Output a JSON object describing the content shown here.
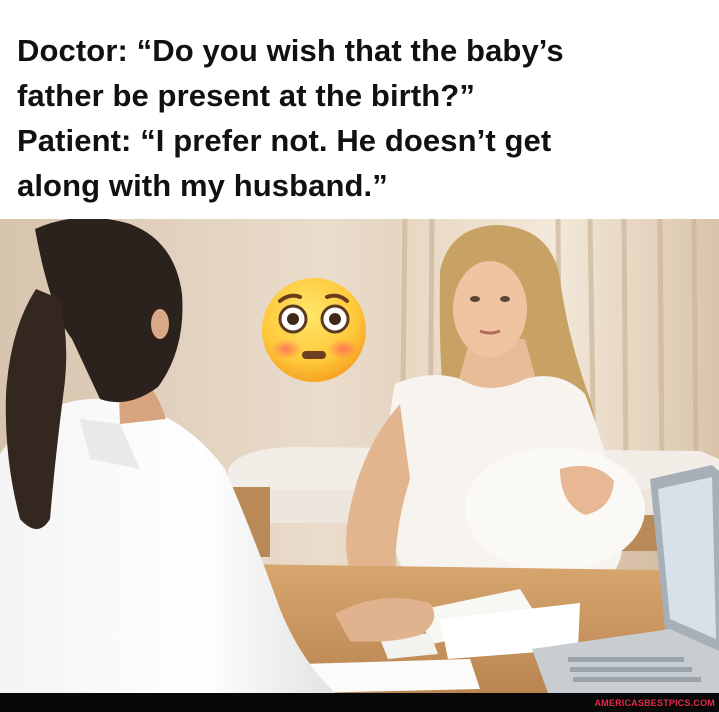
{
  "caption": {
    "lines": [
      "Doctor: “Do you wish that the baby’s",
      "father be present at the birth?”",
      "Patient: “I prefer not. He doesn’t get",
      "along with my husband.”"
    ]
  },
  "photo": {
    "emoji": "flushed-face-icon"
  },
  "watermark": {
    "text": "AMERICASBESTPICS.COM",
    "color": "#e42a4b"
  },
  "colors": {
    "footer_bar": "#080808",
    "caption_text": "#111111"
  }
}
